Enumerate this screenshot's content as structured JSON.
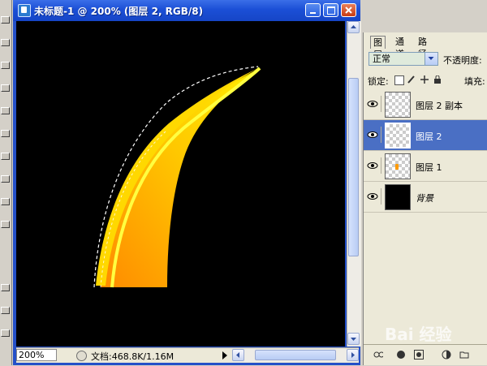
{
  "window": {
    "title": "未标题-1 @ 200% (图层 2, RGB/8)"
  },
  "status": {
    "zoom": "200%",
    "doc_info": "文档:468.8K/1.16M"
  },
  "layers_panel": {
    "tabs": [
      {
        "label": "图层",
        "active": true
      },
      {
        "label": "通道",
        "active": false
      },
      {
        "label": "路径",
        "active": false
      }
    ],
    "blend_mode": "正常",
    "opacity_label": "不透明度:",
    "lock_label": "锁定:",
    "fill_label": "填充:",
    "layers": [
      {
        "name": "图层 2 副本",
        "thumb": "transparent",
        "selected": false
      },
      {
        "name": "图层 2",
        "thumb": "transparent",
        "selected": true
      },
      {
        "name": "图层 1",
        "thumb": "transparent-orange",
        "selected": false
      },
      {
        "name": "背景",
        "thumb": "black",
        "selected": false
      }
    ]
  },
  "colors": {
    "titlebar": "#1b4fd6",
    "selected_layer": "#4a6fc4",
    "shape_light": "#ffee00",
    "shape_dark": "#ff8a00"
  },
  "watermark": {
    "text": "Bai 经验"
  }
}
